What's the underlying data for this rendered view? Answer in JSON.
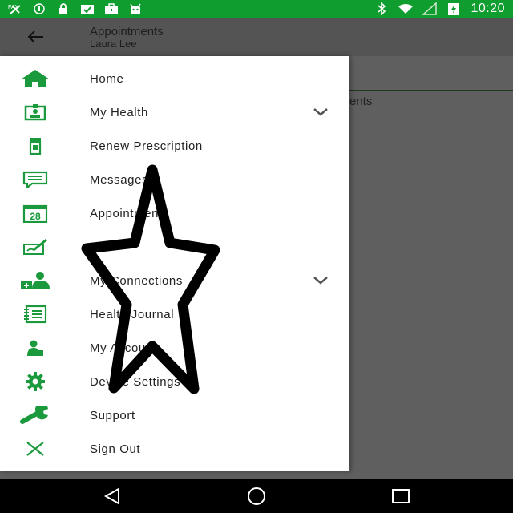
{
  "status_bar": {
    "time": "10:20",
    "left_icons": [
      "fax-icon",
      "info-icon",
      "lock-icon",
      "clipboard-icon",
      "briefcase-icon",
      "android-icon"
    ],
    "right_icons": [
      "bluetooth-icon",
      "wifi-icon",
      "signal-icon",
      "battery-charging-icon"
    ]
  },
  "app_bar": {
    "title": "Appointments",
    "subtitle": "Laura Lee"
  },
  "background": {
    "partial_text": "ents"
  },
  "drawer": {
    "items": [
      {
        "label": "Home",
        "icon": "home-icon",
        "expandable": false
      },
      {
        "label": "My Health",
        "icon": "id-card-icon",
        "expandable": true
      },
      {
        "label": "Renew Prescription",
        "icon": "pill-bottle-icon",
        "expandable": false
      },
      {
        "label": "Messages",
        "icon": "message-icon",
        "expandable": false
      },
      {
        "label": "Appointments",
        "icon": "calendar-icon",
        "expandable": false
      },
      {
        "label": "",
        "icon": "sign-pen-icon",
        "expandable": false
      },
      {
        "label": "My Connections",
        "icon": "add-people-icon",
        "expandable": true
      },
      {
        "label": "Health Journal",
        "icon": "journal-icon",
        "expandable": false
      },
      {
        "label": "My Account",
        "icon": "account-icon",
        "expandable": false
      },
      {
        "label": "Device Settings",
        "icon": "gear-icon",
        "expandable": false
      },
      {
        "label": "Support",
        "icon": "wrench-icon",
        "expandable": false
      },
      {
        "label": "Sign Out",
        "icon": "close-icon",
        "expandable": false
      }
    ]
  },
  "colors": {
    "accent_green": "#0f9d2f",
    "icon_green": "#1a9a3c"
  }
}
